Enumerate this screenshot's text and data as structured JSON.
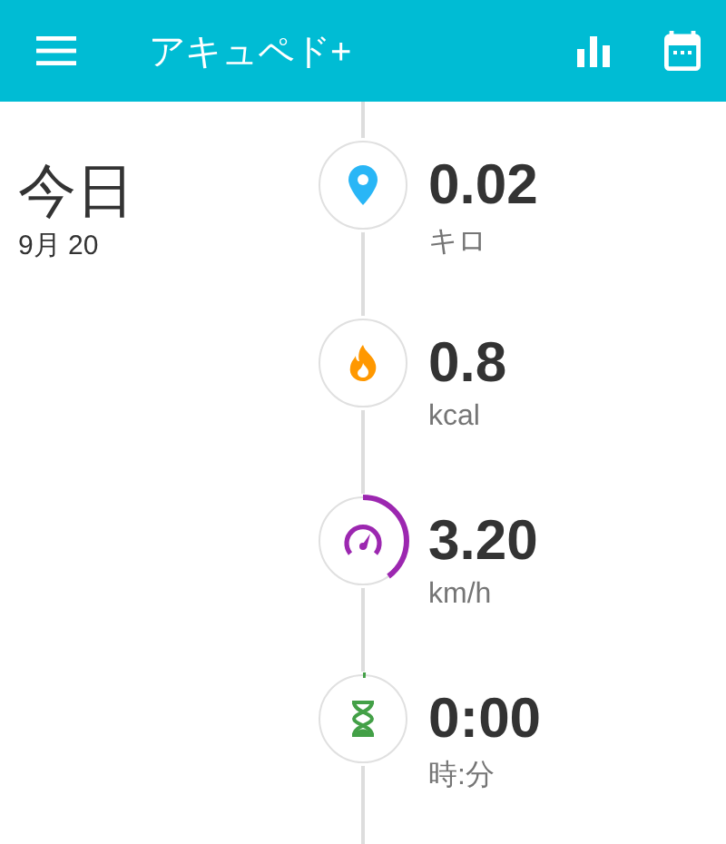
{
  "header": {
    "title": "アキュペド+"
  },
  "day": {
    "title": "今日",
    "date": "9月 20"
  },
  "metrics": [
    {
      "kind": "distance",
      "value": "0.02",
      "unit": "キロ",
      "color": "#29b6f6"
    },
    {
      "kind": "calories",
      "value": "0.8",
      "unit": "kcal",
      "color": "#ff9800"
    },
    {
      "kind": "speed",
      "value": "3.20",
      "unit": "km/h",
      "color": "#9c27b0"
    },
    {
      "kind": "time",
      "value": "0:00",
      "unit": "時:分",
      "color": "#43a047"
    }
  ]
}
